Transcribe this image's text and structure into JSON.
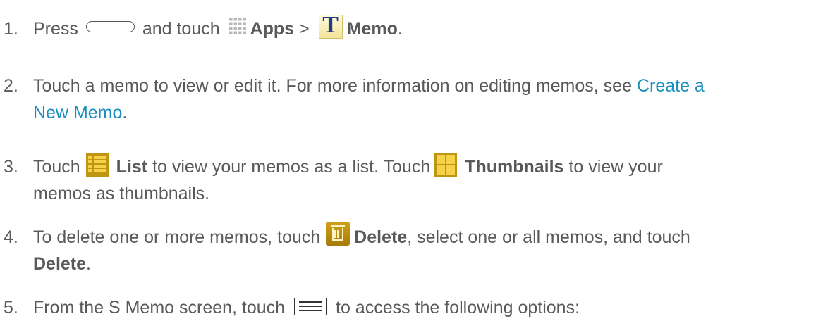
{
  "steps": [
    {
      "num": "1.",
      "t1": "Press",
      "t2": "and touch",
      "apps": "Apps",
      "gt": ">",
      "memo_glyph": "T",
      "memo": "Memo",
      "end": "."
    },
    {
      "num": "2.",
      "t1": "Touch a memo to view or edit it. For more information on editing memos, see",
      "link_a": "Create a",
      "link_b": "New Memo",
      "end": "."
    },
    {
      "num": "3.",
      "t1": "Touch",
      "list": "List",
      "t2": "to view your memos as a list. Touch",
      "thumbs": "Thumbnails",
      "t3": "to view your",
      "t4": "memos as thumbnails."
    },
    {
      "num": "4.",
      "t1": "To delete one or more memos, touch",
      "delete": "Delete",
      "t2": ", select one or all memos, and touch",
      "delete2": "Delete",
      "end": "."
    },
    {
      "num": "5.",
      "t1": "From the S Memo screen, touch",
      "t2": "to access the following options:"
    }
  ],
  "icons": [
    "home-key-icon",
    "apps-icon",
    "memo-icon",
    "list-icon",
    "thumbnails-icon",
    "delete-icon",
    "menu-key-icon"
  ],
  "colors": {
    "text": "#595959",
    "link": "#1a8fbf",
    "icon_gold": "#c0950f",
    "icon_yellow": "#f6d24a"
  }
}
